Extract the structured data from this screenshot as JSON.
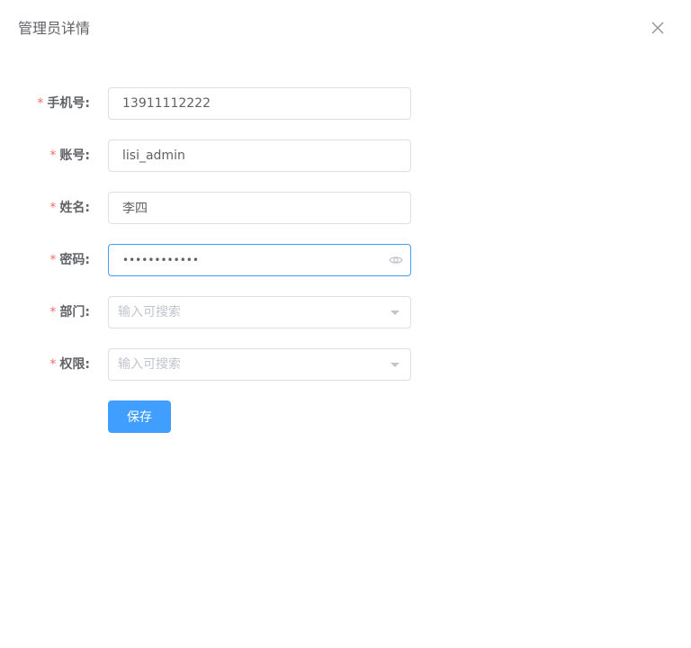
{
  "dialog": {
    "title": "管理员详情",
    "close_icon": "close-icon"
  },
  "form": {
    "required_mark": "*",
    "phone": {
      "label": "手机号:",
      "value": "13911112222"
    },
    "account": {
      "label": "账号:",
      "value": "lisi_admin"
    },
    "name": {
      "label": "姓名:",
      "value": "李四"
    },
    "password": {
      "label": "密码:",
      "value": "lisi12345678",
      "icon": "eye-icon"
    },
    "department": {
      "label": "部门:",
      "placeholder": "输入可搜索",
      "icon": "chevron-down-icon"
    },
    "permission": {
      "label": "权限:",
      "placeholder": "输入可搜索",
      "icon": "chevron-down-icon"
    },
    "save_label": "保存"
  },
  "colors": {
    "primary": "#409eff",
    "required": "#f56c6c",
    "border": "#dcdfe6",
    "placeholder": "#c0c4cc",
    "text": "#606266"
  }
}
